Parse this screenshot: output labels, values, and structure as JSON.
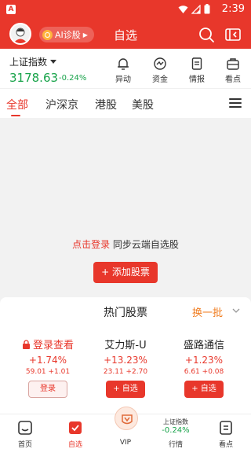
{
  "status_bar": {
    "time": "2:39",
    "app_badge": "A"
  },
  "header": {
    "title": "自选",
    "ai_label": "AI诊股"
  },
  "index_bar": {
    "name": "上证指数",
    "value": "3178.63",
    "change": "-0.24%",
    "quick_actions": [
      {
        "label": "异动",
        "icon": "bell-icon"
      },
      {
        "label": "资金",
        "icon": "fund-flow-icon"
      },
      {
        "label": "情报",
        "icon": "document-icon"
      },
      {
        "label": "看点",
        "icon": "briefcase-icon"
      }
    ]
  },
  "tabs": [
    {
      "label": "全部",
      "active": true
    },
    {
      "label": "沪深京",
      "active": false
    },
    {
      "label": "港股",
      "active": false
    },
    {
      "label": "美股",
      "active": false
    }
  ],
  "empty_state": {
    "login_link": "点击登录",
    "sync_text": "同步云端自选股",
    "add_button": "+ 添加股票"
  },
  "hot_stocks": {
    "title": "热门股票",
    "refresh_label": "换一批",
    "cards": [
      {
        "name": "登录查看",
        "pct": "+1.74%",
        "price": "59.01",
        "change": "+1.01",
        "button": "登录",
        "locked": true
      },
      {
        "name": "艾力斯-U",
        "pct": "+13.23%",
        "price": "23.11",
        "change": "+2.70",
        "button": "+ 自选",
        "locked": false
      },
      {
        "name": "盛路通信",
        "pct": "+1.23%",
        "price": "6.61",
        "change": "+0.08",
        "button": "+ 自选",
        "locked": false
      }
    ]
  },
  "bottom_nav": {
    "home": "首页",
    "watchlist": "自选",
    "vip": "VIP",
    "market_index_name": "上证指数",
    "market_index_value": "-0.24%",
    "market": "行情",
    "highlights": "看点"
  },
  "colors": {
    "brand_red": "#e8372b",
    "down_green": "#18a34a",
    "accent_orange": "#f07c1f"
  }
}
